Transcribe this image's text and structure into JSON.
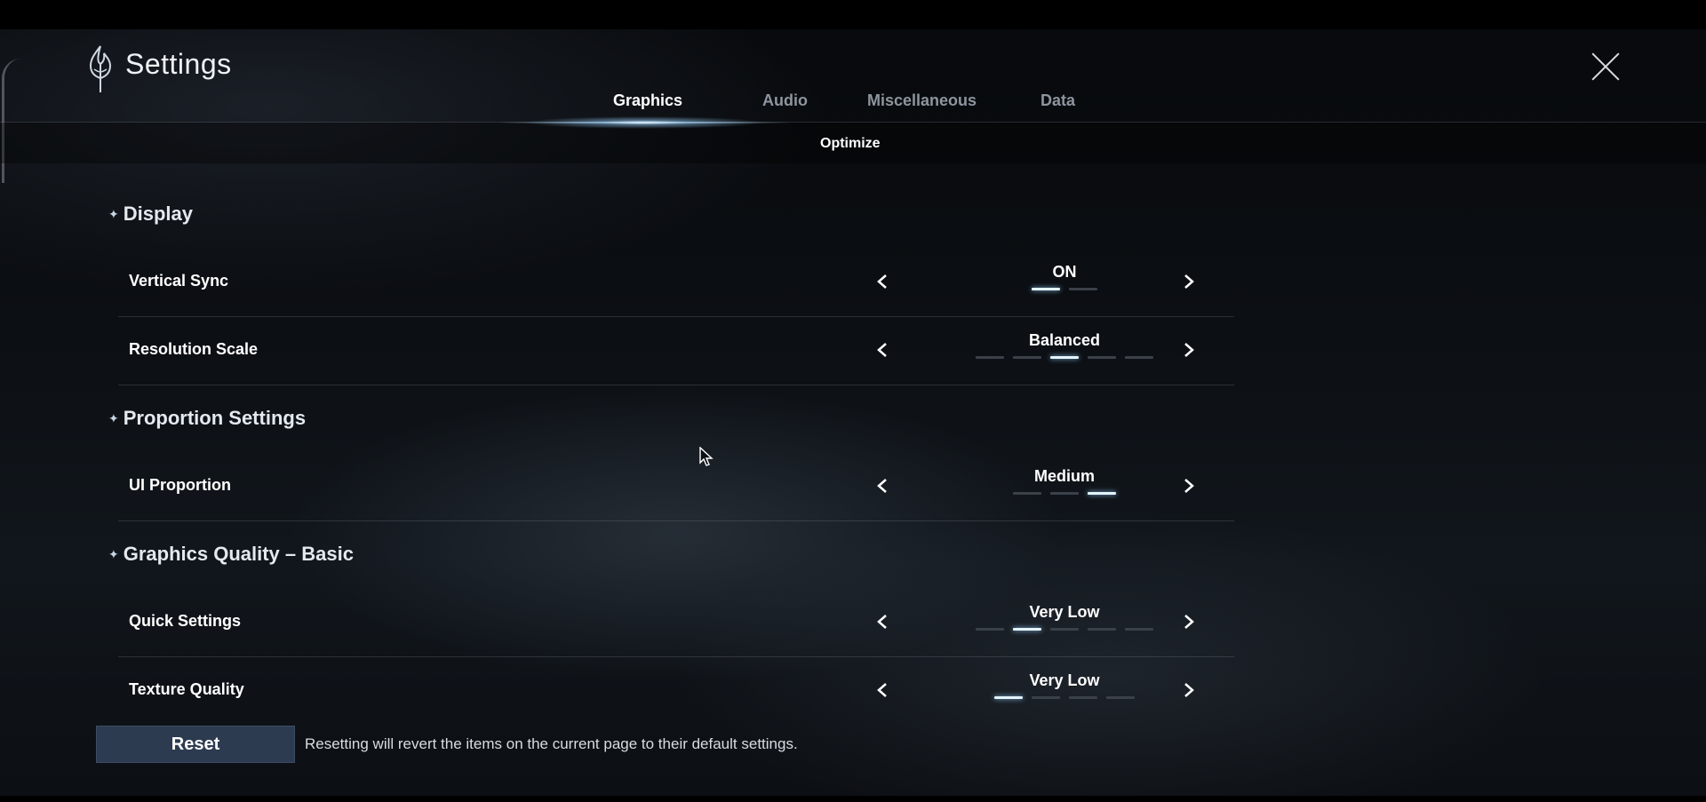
{
  "header": {
    "title": "Settings"
  },
  "tabs": [
    {
      "label": "Graphics",
      "active": true
    },
    {
      "label": "Audio",
      "active": false
    },
    {
      "label": "Miscellaneous",
      "active": false
    },
    {
      "label": "Data",
      "active": false
    }
  ],
  "subtab": {
    "label": "Optimize"
  },
  "sections": [
    {
      "title": "Display",
      "rows": [
        {
          "label": "Vertical Sync",
          "value": "ON",
          "total": 2,
          "selected": 1
        },
        {
          "label": "Resolution Scale",
          "value": "Balanced",
          "total": 5,
          "selected": 3
        }
      ]
    },
    {
      "title": "Proportion Settings",
      "rows": [
        {
          "label": "UI Proportion",
          "value": "Medium",
          "total": 3,
          "selected": 3
        }
      ]
    },
    {
      "title": "Graphics Quality – Basic",
      "rows": [
        {
          "label": "Quick Settings",
          "value": "Very Low",
          "total": 5,
          "selected": 2
        },
        {
          "label": "Texture Quality",
          "value": "Very Low",
          "total": 4,
          "selected": 1
        }
      ]
    }
  ],
  "footer": {
    "reset_label": "Reset",
    "reset_note": "Resetting will revert the items on the current page to their default settings."
  },
  "colors": {
    "accent_glow": "#e4f4ff",
    "reset_button": "#2d3b51",
    "inactive_tab": "#8d959e"
  },
  "icons": {
    "logo": "settings-emblem-icon",
    "close": "close-icon",
    "prev": "chevron-left-icon",
    "next": "chevron-right-icon",
    "cursor": "mouse-cursor-icon"
  }
}
